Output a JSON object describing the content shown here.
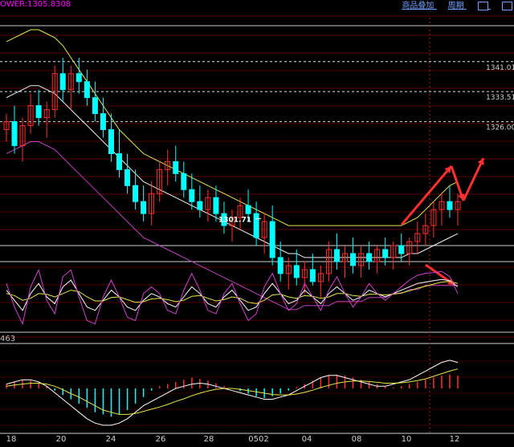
{
  "header": {
    "indicator_readout": "OWER:1305.8308",
    "indicator_color": "#ff00ff"
  },
  "toolbar": {
    "item1": "商品叠加",
    "item2": "周期",
    "icons": [
      "window-restore-icon",
      "window-close-icon"
    ]
  },
  "macd_readout": "463",
  "price_labels": {
    "p1341": "1341.01",
    "p1333": "1333.51",
    "p1326": "1326.00",
    "low_marker": "1301.71"
  },
  "colors": {
    "up": "#ff3030",
    "down": "#00ffff",
    "upper_band": "#e8e84c",
    "mid_band": "#f0f0f0",
    "lower_band": "#c040c0",
    "grid_dash": "#aa2222",
    "arrow": "#ff3030"
  },
  "chart_data": {
    "type": "candlestick",
    "x_tick_labels": [
      "18",
      "20",
      "24",
      "26",
      "28",
      "0502",
      "04",
      "08",
      "10",
      "12"
    ],
    "ylim": [
      1295,
      1350
    ],
    "levels": [
      1341.01,
      1333.51,
      1326.0
    ],
    "low_marker": 1301.71,
    "candles": [
      [
        1324,
        1328,
        1321,
        1326
      ],
      [
        1326,
        1330,
        1318,
        1320
      ],
      [
        1320,
        1327,
        1316,
        1325
      ],
      [
        1325,
        1333,
        1323,
        1330
      ],
      [
        1330,
        1334,
        1325,
        1327
      ],
      [
        1327,
        1331,
        1322,
        1329
      ],
      [
        1329,
        1340,
        1327,
        1338
      ],
      [
        1338,
        1342,
        1331,
        1334
      ],
      [
        1334,
        1340,
        1329,
        1338
      ],
      [
        1338,
        1342,
        1333,
        1336
      ],
      [
        1336,
        1339,
        1330,
        1332
      ],
      [
        1332,
        1336,
        1326,
        1328
      ],
      [
        1328,
        1332,
        1322,
        1324
      ],
      [
        1324,
        1328,
        1316,
        1318
      ],
      [
        1318,
        1324,
        1312,
        1314
      ],
      [
        1314,
        1318,
        1308,
        1310
      ],
      [
        1310,
        1314,
        1304,
        1306
      ],
      [
        1306,
        1310,
        1301,
        1303
      ],
      [
        1303,
        1311,
        1300,
        1308
      ],
      [
        1308,
        1316,
        1306,
        1314
      ],
      [
        1314,
        1319,
        1310,
        1316
      ],
      [
        1316,
        1320,
        1311,
        1313
      ],
      [
        1313,
        1316,
        1307,
        1309
      ],
      [
        1309,
        1313,
        1304,
        1306
      ],
      [
        1306,
        1310,
        1302,
        1304
      ],
      [
        1304,
        1309,
        1301,
        1307
      ],
      [
        1307,
        1310,
        1301,
        1303
      ],
      [
        1303,
        1306,
        1298,
        1300
      ],
      [
        1300,
        1304,
        1296,
        1302
      ],
      [
        1302,
        1307,
        1299,
        1305
      ],
      [
        1305,
        1309,
        1301,
        1303
      ],
      [
        1303,
        1306,
        1295,
        1297
      ],
      [
        1297,
        1303,
        1293,
        1301
      ],
      [
        1301,
        1305,
        1290,
        1292
      ],
      [
        1292,
        1296,
        1286,
        1288
      ],
      [
        1288,
        1292,
        1284,
        1290
      ],
      [
        1290,
        1294,
        1285,
        1287
      ],
      [
        1287,
        1291,
        1283,
        1289
      ],
      [
        1289,
        1293,
        1285,
        1286
      ],
      [
        1286,
        1290,
        1282,
        1288
      ],
      [
        1288,
        1296,
        1286,
        1294
      ],
      [
        1294,
        1298,
        1289,
        1291
      ],
      [
        1291,
        1295,
        1287,
        1293
      ],
      [
        1293,
        1297,
        1288,
        1290
      ],
      [
        1290,
        1295,
        1287,
        1293
      ],
      [
        1293,
        1296,
        1289,
        1291
      ],
      [
        1291,
        1295,
        1288,
        1294
      ],
      [
        1294,
        1297,
        1290,
        1292
      ],
      [
        1292,
        1296,
        1289,
        1295
      ],
      [
        1295,
        1298,
        1291,
        1293
      ],
      [
        1293,
        1297,
        1290,
        1296
      ],
      [
        1296,
        1301,
        1293,
        1298
      ],
      [
        1298,
        1303,
        1295,
        1300
      ],
      [
        1300,
        1306,
        1297,
        1304
      ],
      [
        1304,
        1308,
        1300,
        1306
      ],
      [
        1306,
        1310,
        1302,
        1304
      ],
      [
        1304,
        1308,
        1300,
        1306
      ]
    ],
    "series": [
      {
        "name": "upper_band",
        "values": [
          1346,
          1347,
          1348,
          1349,
          1349,
          1348,
          1347,
          1345,
          1342,
          1339,
          1336,
          1333,
          1330,
          1327,
          1324,
          1322,
          1320,
          1318,
          1317,
          1316,
          1315,
          1314,
          1313,
          1312,
          1311,
          1310,
          1309,
          1308,
          1307,
          1306,
          1305,
          1304,
          1303,
          1302,
          1301,
          1300,
          1300,
          1300,
          1300,
          1300,
          1300,
          1300,
          1300,
          1300,
          1300,
          1300,
          1300,
          1300,
          1300,
          1300,
          1301,
          1302,
          1304,
          1306,
          1308,
          1310,
          1311
        ]
      },
      {
        "name": "mid_band",
        "values": [
          1332,
          1333,
          1334,
          1335,
          1335,
          1334,
          1333,
          1331,
          1329,
          1327,
          1325,
          1323,
          1321,
          1319,
          1317,
          1315,
          1313,
          1311,
          1310,
          1309,
          1308,
          1307,
          1306,
          1305,
          1304,
          1303,
          1302,
          1301,
          1300,
          1299,
          1298,
          1297,
          1296,
          1295,
          1294,
          1293,
          1293,
          1292,
          1292,
          1292,
          1292,
          1292,
          1292,
          1292,
          1292,
          1292,
          1292,
          1292,
          1292,
          1292,
          1293,
          1293,
          1294,
          1295,
          1296,
          1297,
          1298
        ]
      },
      {
        "name": "lower_band",
        "values": [
          1318,
          1319,
          1320,
          1321,
          1321,
          1320,
          1319,
          1317,
          1315,
          1313,
          1311,
          1309,
          1307,
          1305,
          1303,
          1301,
          1299,
          1297,
          1296,
          1295,
          1294,
          1293,
          1292,
          1291,
          1290,
          1289,
          1288,
          1287,
          1286,
          1285,
          1284,
          1283,
          1282,
          1281,
          1280,
          1279,
          1279,
          1280,
          1280,
          1280,
          1280,
          1281,
          1281,
          1281,
          1281,
          1282,
          1282,
          1282,
          1283,
          1283,
          1284,
          1284,
          1285,
          1285,
          1285,
          1285,
          1285
        ]
      }
    ],
    "oscillator": {
      "ylim": [
        0,
        100
      ],
      "series": [
        {
          "name": "K",
          "values": [
            60,
            45,
            30,
            55,
            70,
            50,
            40,
            65,
            75,
            55,
            35,
            30,
            45,
            60,
            50,
            35,
            30,
            45,
            55,
            50,
            40,
            35,
            50,
            65,
            55,
            40,
            35,
            50,
            60,
            45,
            30,
            35,
            55,
            70,
            55,
            40,
            45,
            60,
            50,
            40,
            55,
            65,
            55,
            45,
            50,
            60,
            55,
            50,
            55,
            60,
            65,
            70,
            72,
            74,
            76,
            74,
            65
          ]
        },
        {
          "name": "D",
          "values": [
            55,
            52,
            45,
            48,
            55,
            54,
            50,
            55,
            60,
            58,
            50,
            44,
            44,
            49,
            50,
            46,
            42,
            43,
            47,
            48,
            46,
            43,
            45,
            51,
            52,
            48,
            44,
            46,
            50,
            48,
            42,
            40,
            45,
            53,
            54,
            50,
            48,
            52,
            51,
            48,
            50,
            55,
            55,
            52,
            51,
            54,
            54,
            53,
            54,
            56,
            59,
            63,
            66,
            69,
            72,
            73,
            70
          ]
        },
        {
          "name": "J",
          "values": [
            70,
            35,
            10,
            65,
            90,
            45,
            25,
            80,
            90,
            50,
            15,
            10,
            50,
            75,
            50,
            20,
            15,
            55,
            65,
            55,
            30,
            25,
            60,
            85,
            60,
            30,
            25,
            55,
            70,
            40,
            15,
            25,
            65,
            85,
            55,
            30,
            40,
            70,
            50,
            30,
            60,
            80,
            55,
            35,
            50,
            70,
            55,
            45,
            55,
            65,
            75,
            82,
            85,
            86,
            88,
            80,
            55
          ]
        }
      ]
    },
    "macd": {
      "ylim": [
        -10,
        10
      ],
      "histogram": [
        1,
        1.5,
        2,
        1.8,
        1.2,
        0.5,
        -0.5,
        -1.5,
        -2.5,
        -3.5,
        -4.5,
        -5.5,
        -6,
        -6.5,
        -6,
        -5,
        -3.5,
        -2,
        -0.5,
        0.5,
        1,
        1.5,
        2,
        2.5,
        2.2,
        1.8,
        1.2,
        0.6,
        0,
        -0.6,
        -1.2,
        -1.8,
        -2.2,
        -1.8,
        -1.2,
        -0.5,
        0.3,
        1,
        1.8,
        2.5,
        3,
        3.2,
        3,
        2.5,
        2,
        1.5,
        1,
        0.5,
        0.2,
        0.5,
        1,
        1.5,
        2,
        2.5,
        3,
        3.2,
        3
      ],
      "series": [
        {
          "name": "DIF",
          "values": [
            1,
            1.5,
            2,
            2,
            1.5,
            0.5,
            -1,
            -2.5,
            -4,
            -5.5,
            -7,
            -8,
            -8.5,
            -8.5,
            -8,
            -7,
            -5.5,
            -4,
            -3,
            -2,
            -1,
            0,
            0.5,
            1,
            1.2,
            1,
            0.5,
            0,
            -0.5,
            -1,
            -1.5,
            -2,
            -2.5,
            -2.5,
            -2,
            -1.5,
            -0.5,
            0.5,
            1.5,
            2.5,
            3,
            3,
            2.5,
            2,
            1.5,
            1,
            0.5,
            0.5,
            1,
            1.5,
            2,
            3,
            4,
            5,
            6,
            6.5,
            6
          ]
        },
        {
          "name": "DEA",
          "values": [
            0.5,
            0.8,
            1,
            1.2,
            1.2,
            1,
            0.5,
            -0.3,
            -1.2,
            -2,
            -3,
            -4,
            -5,
            -5.5,
            -6,
            -6,
            -5.8,
            -5.3,
            -4.8,
            -4.3,
            -3.7,
            -3,
            -2.4,
            -1.7,
            -1.1,
            -0.6,
            -0.2,
            0,
            0,
            -0.2,
            -0.5,
            -0.8,
            -1.1,
            -1.4,
            -1.5,
            -1.5,
            -1.3,
            -0.9,
            -0.4,
            0.2,
            0.7,
            1.2,
            1.5,
            1.7,
            1.7,
            1.6,
            1.4,
            1.2,
            1.2,
            1.3,
            1.5,
            1.8,
            2.2,
            2.8,
            3.4,
            4,
            4.5
          ]
        }
      ]
    }
  }
}
